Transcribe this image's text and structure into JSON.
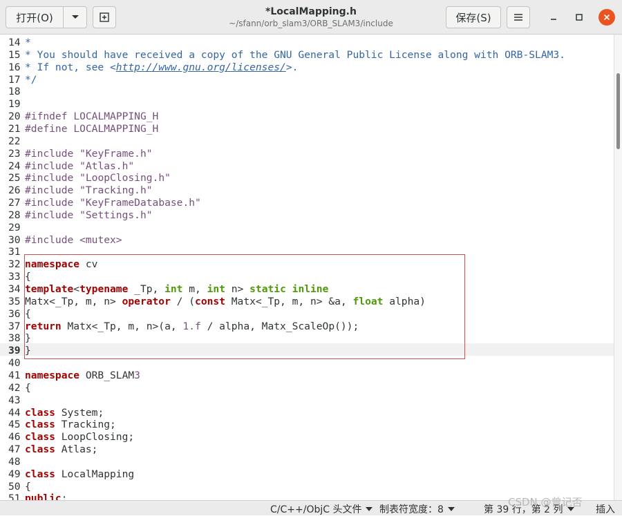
{
  "header": {
    "open_label": "打开(O)",
    "save_label": "保存(S)",
    "title": "*LocalMapping.h",
    "path": "~/sfann/orb_slam3/ORB_SLAM3/include"
  },
  "colors": {
    "keyword": "#a40000",
    "type": "#4e9a06",
    "string": "#75507b",
    "comment": "#3465a4",
    "highlight_box": "#d24d4d",
    "close_button": "#e95420"
  },
  "editor": {
    "current_line": 39,
    "lines": [
      {
        "n": "14",
        "t": "*"
      },
      {
        "n": "15",
        "t": "* You should have received a copy of the GNU General Public License along with ORB-SLAM3."
      },
      {
        "n": "16",
        "t": "* If not, see <http://www.gnu.org/licenses/>."
      },
      {
        "n": "17",
        "t": "*/"
      },
      {
        "n": "18",
        "t": ""
      },
      {
        "n": "19",
        "t": ""
      },
      {
        "n": "20",
        "t": "#ifndef LOCALMAPPING_H"
      },
      {
        "n": "21",
        "t": "#define LOCALMAPPING_H"
      },
      {
        "n": "22",
        "t": ""
      },
      {
        "n": "23",
        "t": "#include \"KeyFrame.h\""
      },
      {
        "n": "24",
        "t": "#include \"Atlas.h\""
      },
      {
        "n": "25",
        "t": "#include \"LoopClosing.h\""
      },
      {
        "n": "26",
        "t": "#include \"Tracking.h\""
      },
      {
        "n": "27",
        "t": "#include \"KeyFrameDatabase.h\""
      },
      {
        "n": "28",
        "t": "#include \"Settings.h\""
      },
      {
        "n": "29",
        "t": ""
      },
      {
        "n": "30",
        "t": "#include <mutex>"
      },
      {
        "n": "31",
        "t": ""
      },
      {
        "n": "32",
        "t": "namespace cv"
      },
      {
        "n": "33",
        "t": "{"
      },
      {
        "n": "34",
        "t": "template<typename _Tp, int m, int n> static inline"
      },
      {
        "n": "35",
        "t": "Matx<_Tp, m, n> operator / (const Matx<_Tp, m, n> &a, float alpha)"
      },
      {
        "n": "36",
        "t": "{"
      },
      {
        "n": "37",
        "t": "return Matx<_Tp, m, n>(a, 1.f / alpha, Matx_ScaleOp());"
      },
      {
        "n": "38",
        "t": "}"
      },
      {
        "n": "39",
        "t": "}"
      },
      {
        "n": "40",
        "t": ""
      },
      {
        "n": "41",
        "t": "namespace ORB_SLAM3"
      },
      {
        "n": "42",
        "t": "{"
      },
      {
        "n": "43",
        "t": ""
      },
      {
        "n": "44",
        "t": "class System;"
      },
      {
        "n": "45",
        "t": "class Tracking;"
      },
      {
        "n": "46",
        "t": "class LoopClosing;"
      },
      {
        "n": "47",
        "t": "class Atlas;"
      },
      {
        "n": "48",
        "t": ""
      },
      {
        "n": "49",
        "t": "class LocalMapping"
      },
      {
        "n": "50",
        "t": "{"
      },
      {
        "n": "51",
        "t": "public:"
      }
    ]
  },
  "statusbar": {
    "language": "C/C++/ObjC 头文件",
    "tab_width": "制表符宽度：8",
    "position": "第 39 行，第 2 列",
    "mode": "插入"
  },
  "watermark": "CSDN @曾记否"
}
